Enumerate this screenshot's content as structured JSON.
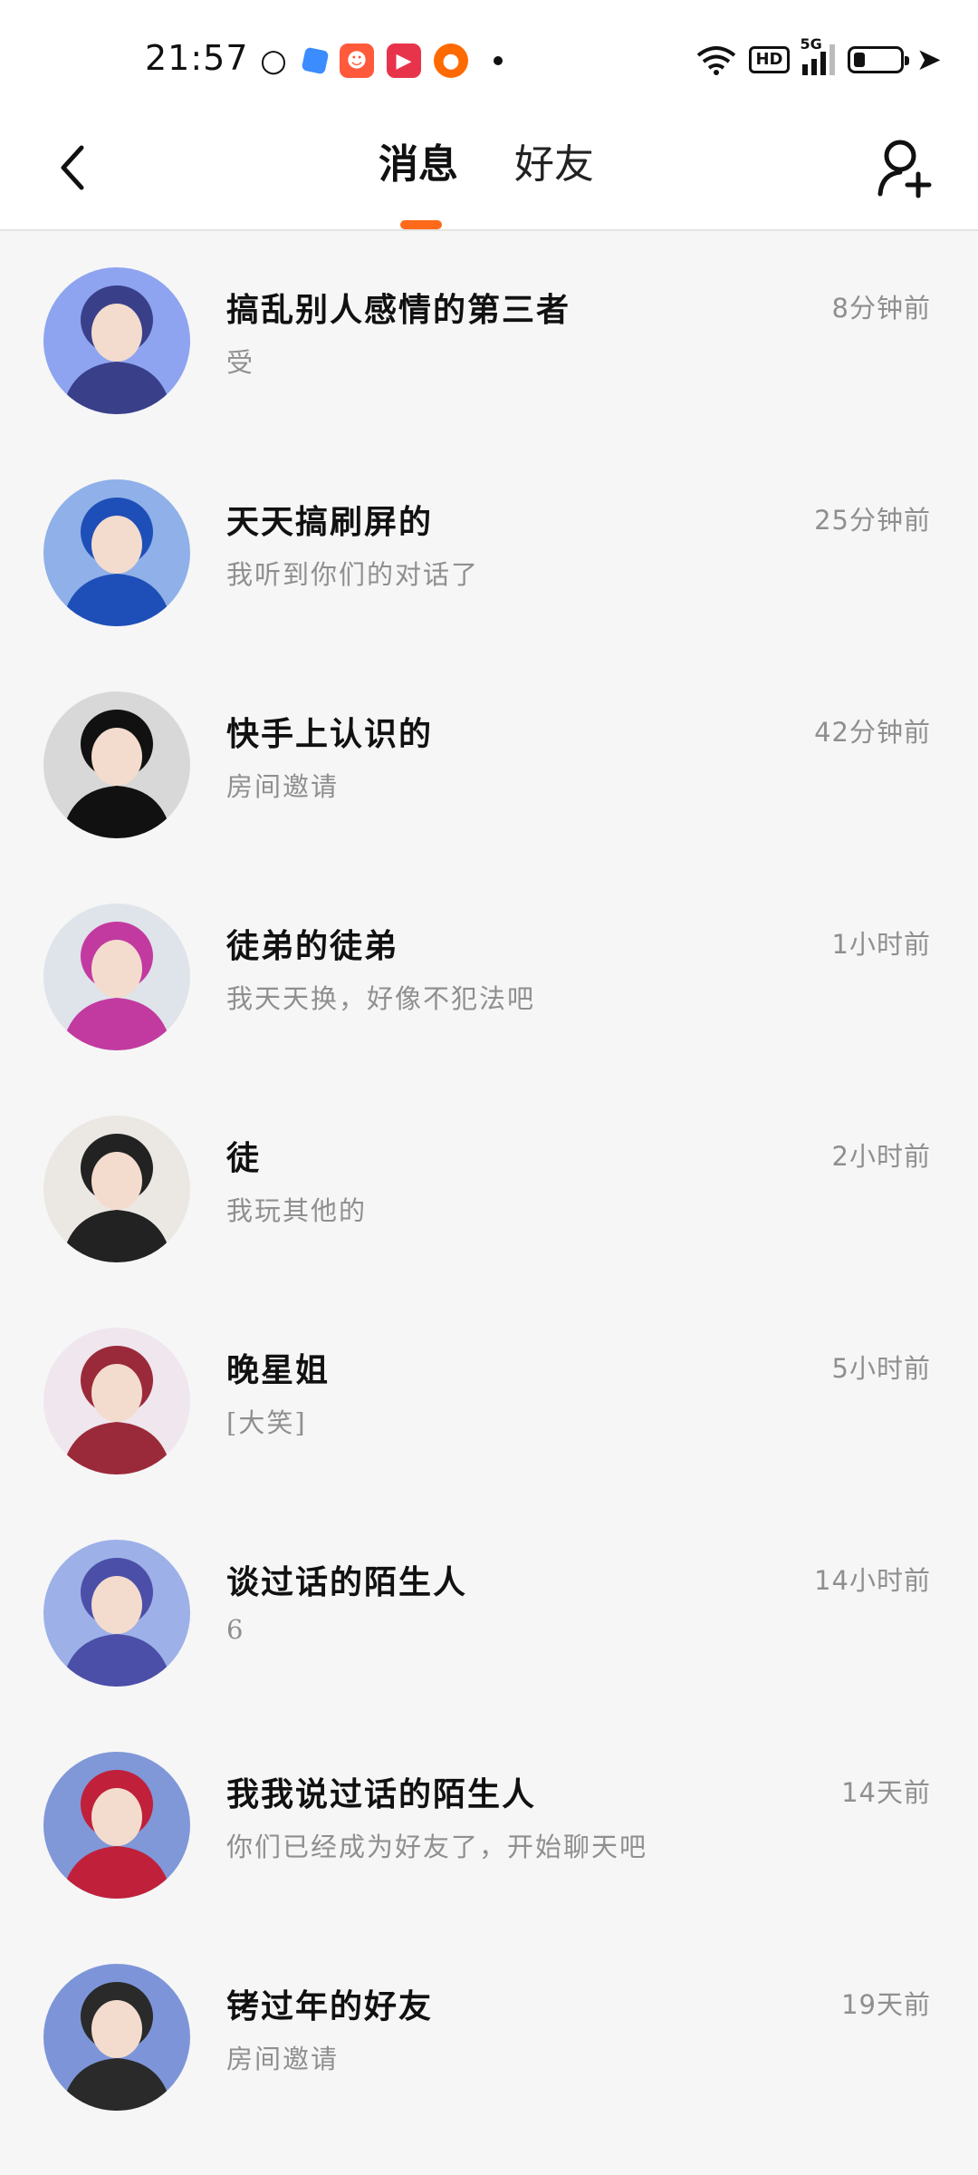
{
  "status_bar": {
    "time": "21:57",
    "app_icons": [
      "wechat-icon",
      "blue-app-icon",
      "kuaishou-icon",
      "video-app-icon",
      "orange-app-icon"
    ],
    "network": "5G",
    "hd": "HD",
    "battery_level": 0.25,
    "charging": true
  },
  "nav": {
    "tabs": [
      {
        "label": "消息",
        "active": true
      },
      {
        "label": "好友",
        "active": false
      }
    ],
    "accent_color": "#ff6a1a"
  },
  "conversations": [
    {
      "name": "搞乱别人感情的第三者",
      "preview": "受",
      "time": "8分钟前",
      "avatar_bg": "#8ea4f0",
      "avatar_fg": "#3a3f8a"
    },
    {
      "name": "天天搞刷屏的",
      "preview": "我听到你们的对话了",
      "time": "25分钟前",
      "avatar_bg": "#8fb0e8",
      "avatar_fg": "#1e4fb8"
    },
    {
      "name": "快手上认识的",
      "preview": "房间邀请",
      "time": "42分钟前",
      "avatar_bg": "#d8d8d8",
      "avatar_fg": "#111111"
    },
    {
      "name": "徒弟的徒弟",
      "preview": "我天天换，好像不犯法吧",
      "time": "1小时前",
      "avatar_bg": "#dfe3ea",
      "avatar_fg": "#c23aa0"
    },
    {
      "name": "徒",
      "preview": "我玩其他的",
      "time": "2小时前",
      "avatar_bg": "#ebe8e4",
      "avatar_fg": "#222222"
    },
    {
      "name": "晚星姐",
      "preview": "[大笑]",
      "time": "5小时前",
      "avatar_bg": "#efe6ee",
      "avatar_fg": "#9a2a3a"
    },
    {
      "name": "谈过话的陌生人",
      "preview": "6",
      "time": "14小时前",
      "avatar_bg": "#9db0e8",
      "avatar_fg": "#4b4fa8"
    },
    {
      "name": "我我说过话的陌生人",
      "preview": "你们已经成为好友了，开始聊天吧",
      "time": "14天前",
      "avatar_bg": "#8097d8",
      "avatar_fg": "#c0203a"
    },
    {
      "name": "铐过年的好友",
      "preview": "房间邀请",
      "time": "19天前",
      "avatar_bg": "#7d95d8",
      "avatar_fg": "#2a2a2a"
    }
  ]
}
